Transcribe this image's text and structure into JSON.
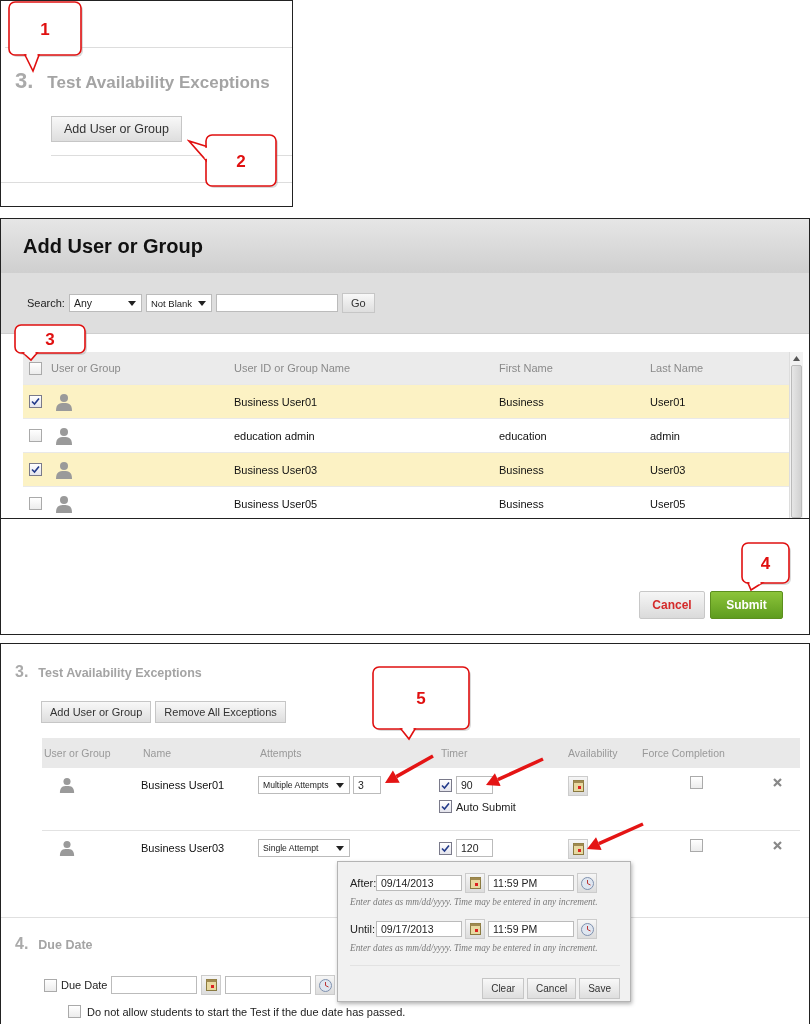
{
  "step_one": {
    "section_number": "3.",
    "section_title": "Test Availability Exceptions",
    "button": "Add User or Group"
  },
  "dialog": {
    "title": "Add User or Group",
    "search": {
      "label": "Search:",
      "field": "Any",
      "condition": "Not Blank",
      "go": "Go"
    },
    "columns": [
      "User or Group",
      "User ID or Group Name",
      "First Name",
      "Last Name"
    ],
    "select_all_checked": false,
    "rows": [
      {
        "selected": true,
        "user_id": "Business User01",
        "first_name": "Business",
        "last_name": "User01"
      },
      {
        "selected": false,
        "user_id": "education admin",
        "first_name": "education",
        "last_name": "admin"
      },
      {
        "selected": true,
        "user_id": "Business User03",
        "first_name": "Business",
        "last_name": "User03"
      },
      {
        "selected": false,
        "user_id": "Business User05",
        "first_name": "Business",
        "last_name": "User05"
      }
    ],
    "buttons": [
      {
        "label": "Cancel",
        "kind": "cancel"
      },
      {
        "label": "Submit",
        "kind": "submit"
      }
    ]
  },
  "exceptions": {
    "section_number": "3.",
    "section_title": "Test Availability Exceptions",
    "buttons": [
      "Add User or Group",
      "Remove All Exceptions"
    ],
    "columns": [
      "User or Group",
      "Name",
      "Attempts",
      "Timer",
      "Availability",
      "Force Completion"
    ],
    "rows": [
      {
        "name": "Business User01",
        "attempts": "Multiple Attempts",
        "attempts_count": "3",
        "timer_on": true,
        "timer": "90",
        "auto_submit": {
          "label": "Auto Submit",
          "checked": true
        },
        "force_completion": false
      },
      {
        "name": "Business User03",
        "attempts": "Single Attempt",
        "timer_on": true,
        "timer": "120",
        "force_completion": false
      }
    ]
  },
  "availability_popup": {
    "fields": [
      {
        "label": "After:",
        "date": "09/14/2013",
        "time": "11:59 PM",
        "hint": "Enter dates as mm/dd/yyyy. Time may be entered in any increment."
      },
      {
        "label": "Until:",
        "date": "09/17/2013",
        "time": "11:59 PM",
        "hint": "Enter dates as mm/dd/yyyy. Time may be entered in any increment."
      }
    ],
    "buttons": [
      "Clear",
      "Cancel",
      "Save"
    ]
  },
  "due_date": {
    "section_number": "4.",
    "section_title": "Due Date",
    "due": {
      "label": "Due Date",
      "checked": false
    },
    "block_late": {
      "label": "Do not allow students to start the Test if the due date has passed.",
      "checked": false
    }
  },
  "callouts": [
    "1",
    "2",
    "3",
    "4",
    "5"
  ]
}
